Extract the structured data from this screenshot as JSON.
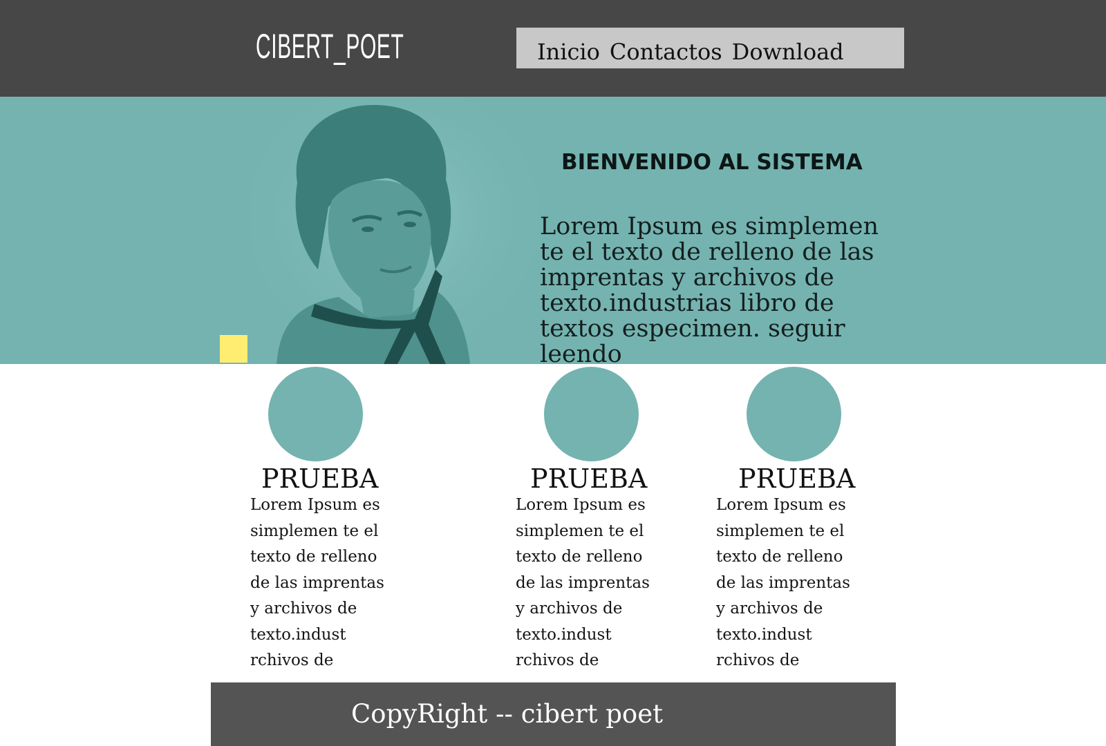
{
  "header": {
    "logo": "CIBERT_POET",
    "nav": [
      "Inicio",
      "Contactos",
      "Download"
    ]
  },
  "hero": {
    "image_icon": "portrait-photo",
    "title": "BIENVENIDO AL SISTEMA",
    "text": "Lorem Ipsum es simplemen te el texto de relleno de las imprentas y archivos de texto.industrias libro de textos especimen. seguir leendo"
  },
  "features": [
    {
      "title": "PRUEBA",
      "lines": [
        "Lorem Ipsum es",
        "simplemen te el",
        "texto de relleno",
        "de las imprentas",
        "y  archivos de",
        "texto.indust",
        "rchivos de"
      ]
    },
    {
      "title": "PRUEBA",
      "lines": [
        "Lorem Ipsum es",
        "simplemen te el",
        "texto de relleno",
        "de las imprentas",
        "y  archivos de",
        "texto.indust",
        "rchivos de"
      ]
    },
    {
      "title": "PRUEBA",
      "lines": [
        "Lorem Ipsum es",
        "simplemen te el",
        "texto de relleno",
        "de las imprentas",
        "y  archivos de",
        "texto.indust",
        "rchivos de"
      ]
    }
  ],
  "footer": {
    "text": "CopyRight -- cibert poet"
  },
  "colors": {
    "header_bg": "#474747",
    "nav_bg": "#c8c8c8",
    "teal": "#74b3b0",
    "accent_yellow": "#ffed72",
    "footer_bg": "#545454"
  }
}
